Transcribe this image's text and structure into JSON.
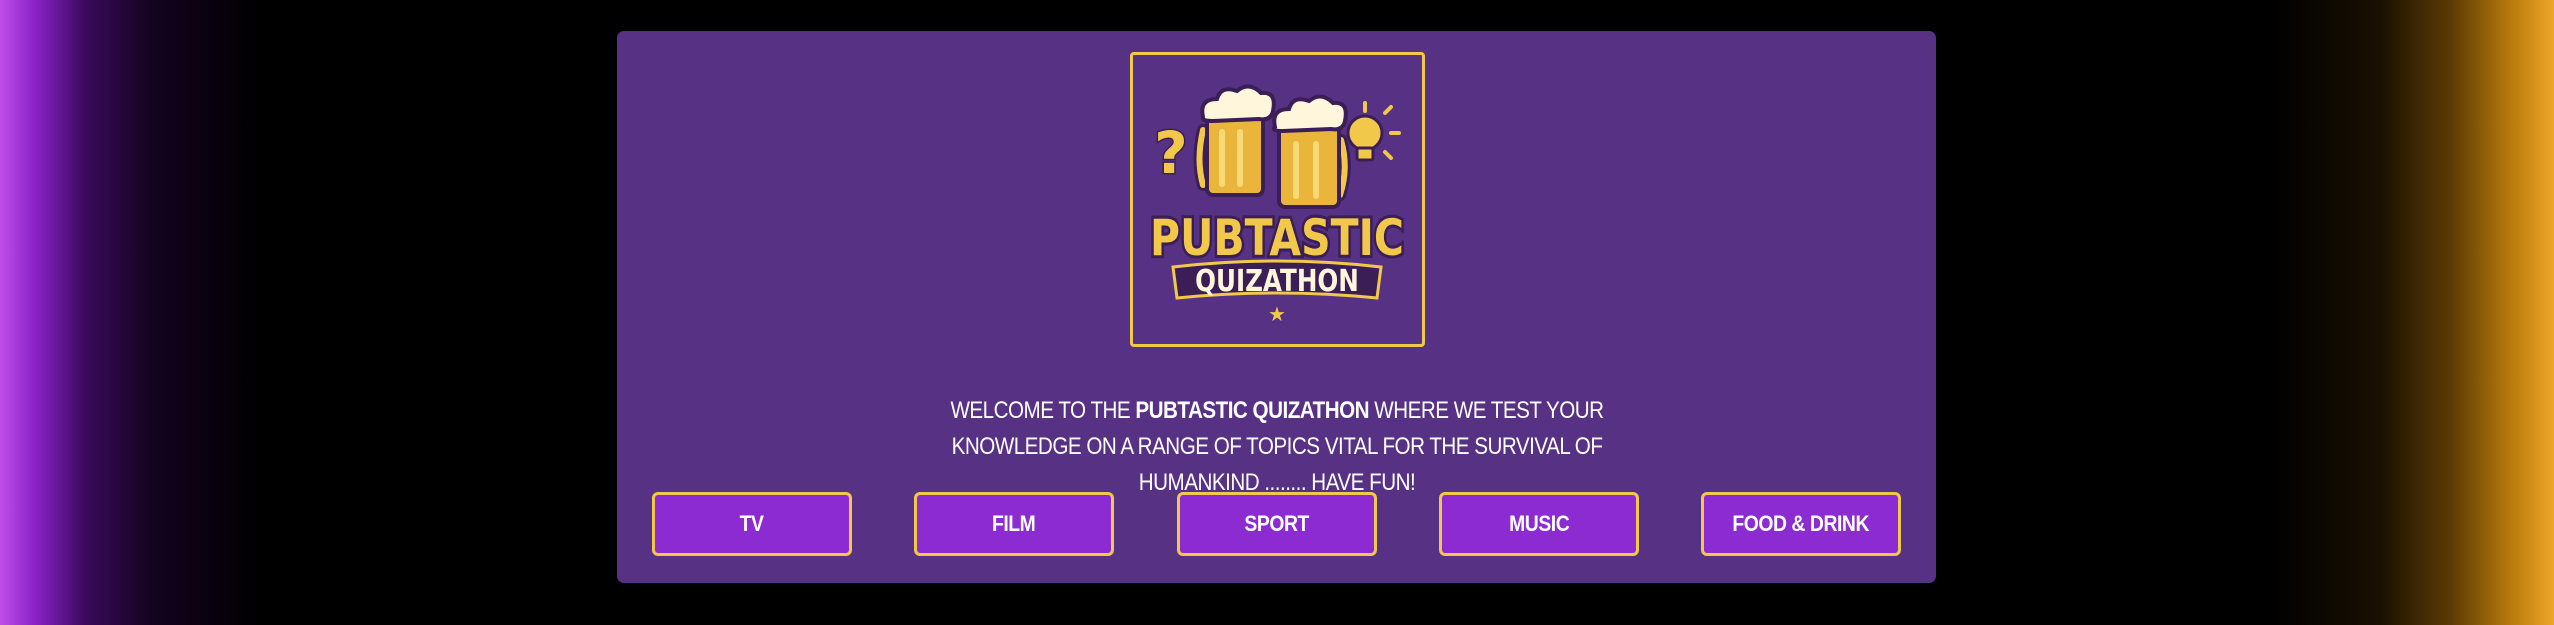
{
  "logo": {
    "line1": "PUBTASTIC",
    "line2": "QUIZATHON",
    "question_mark": "?",
    "star": "★",
    "colors": {
      "gold": "#f2c84b",
      "purple": "#573184",
      "dark": "#3b1e56"
    }
  },
  "welcome": {
    "prefix": "Welcome to the ",
    "brand": "Pubtastic Quizathon",
    "suffix": " where we test your knowledge on a range of topics vital for the survival of humankind ........ have fun!"
  },
  "categories": [
    {
      "label": "TV"
    },
    {
      "label": "FILM"
    },
    {
      "label": "SPORT"
    },
    {
      "label": "MUSIC"
    },
    {
      "label": "FOOD & DRINK"
    }
  ],
  "colors": {
    "panel": "#573184",
    "button": "#8b2bd1",
    "button_border": "#f2c84b",
    "left_glow": "#c04fe8",
    "right_glow": "#eea526"
  }
}
